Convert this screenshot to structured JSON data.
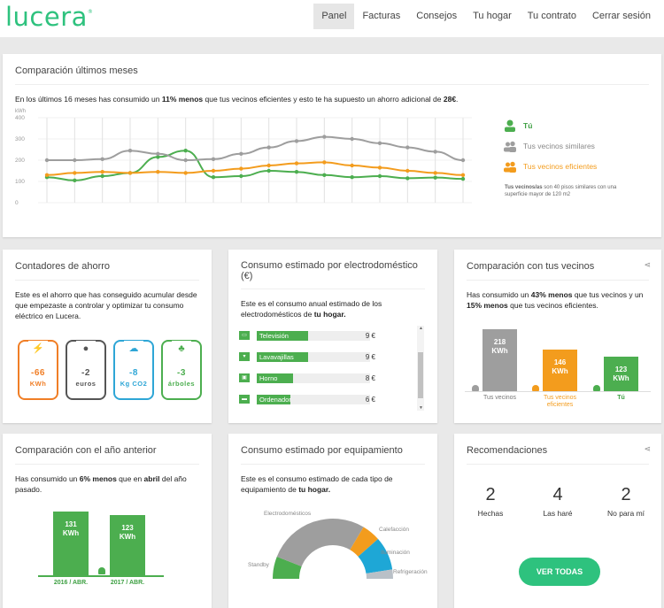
{
  "brand": {
    "name": "lucera",
    "accent": "#2ec27e"
  },
  "nav": [
    "Panel",
    "Facturas",
    "Consejos",
    "Tu hogar",
    "Tu contrato",
    "Cerrar sesión"
  ],
  "comparison": {
    "title": "Comparación últimos meses",
    "desc_pre": "En los últimos 16 meses has consumido un ",
    "desc_pct": "11% menos",
    "desc_mid": " que tus vecinos eficientes y esto te ha supuesto un ahorro adicional de ",
    "desc_amount": "28€",
    "desc_end": ".",
    "legend": [
      "Tú",
      "Tus vecinos similares",
      "Tus vecinos eficientes"
    ],
    "note_bold": "Tus vecinos/as",
    "note": " son 40 pisos similares con una superficie mayor de 120 m2"
  },
  "chart_data": {
    "type": "line",
    "ylabel": "kWh",
    "ylim": [
      0,
      400
    ],
    "yticks": [
      "0",
      "100",
      "200",
      "300",
      "400"
    ],
    "x": [
      1,
      2,
      3,
      4,
      5,
      6,
      7,
      8,
      9,
      10,
      11,
      12,
      13,
      14,
      15,
      16
    ],
    "series": [
      {
        "name": "Tú",
        "color": "#4cae4f",
        "values": [
          120,
          105,
          125,
          140,
          215,
          245,
          120,
          125,
          150,
          145,
          130,
          120,
          125,
          115,
          118,
          112
        ]
      },
      {
        "name": "Tus vecinos similares",
        "color": "#9e9e9e",
        "values": [
          200,
          200,
          205,
          245,
          230,
          200,
          205,
          230,
          260,
          290,
          310,
          300,
          280,
          260,
          240,
          200
        ]
      },
      {
        "name": "Tus vecinos eficientes",
        "color": "#f39c1d",
        "values": [
          130,
          140,
          145,
          140,
          145,
          140,
          150,
          160,
          175,
          185,
          190,
          175,
          165,
          150,
          140,
          130
        ]
      }
    ]
  },
  "counters": {
    "title": "Contadores de ahorro",
    "desc": "Este es el ahorro que has conseguido acumular desde que empezaste a controlar y optimizar tu consumo eléctrico en Lucera.",
    "items": [
      {
        "icon": "bolt-icon",
        "glyph": "⚡",
        "value": "-66",
        "unit": "KWh",
        "color": "#f07e26"
      },
      {
        "icon": "piggy-bank-icon",
        "glyph": "●",
        "value": "-2",
        "unit": "euros",
        "color": "#555555"
      },
      {
        "icon": "cloud-icon",
        "glyph": "☁",
        "value": "-8",
        "unit": "Kg CO2",
        "color": "#2ea6d6"
      },
      {
        "icon": "tree-icon",
        "glyph": "♣",
        "value": "-3",
        "unit": "árboles",
        "color": "#4cae4f"
      }
    ]
  },
  "appliances": {
    "title": "Consumo estimado por electrodoméstico (€)",
    "desc_pre": "Este es el consumo anual estimado de los electrodomésticos de ",
    "desc_bold": "tu hogar.",
    "items": [
      {
        "name": "Televisión",
        "value": "9 €",
        "fill": 0.45,
        "icon": "tv-icon"
      },
      {
        "name": "Lavavajillas",
        "value": "9 €",
        "fill": 0.45,
        "icon": "dishwasher-icon"
      },
      {
        "name": "Horno",
        "value": "8 €",
        "fill": 0.32,
        "icon": "oven-icon"
      },
      {
        "name": "Ordenador",
        "value": "6 €",
        "fill": 0.3,
        "icon": "laptop-icon"
      }
    ]
  },
  "neighbors": {
    "title": "Comparación con tus vecinos",
    "desc_pre": "Has consumido un ",
    "desc_pct1": "43% menos",
    "desc_mid": " que tus vecinos y un ",
    "desc_pct2": "15% menos",
    "desc_end": " que tus vecinos eficientes.",
    "bars": [
      {
        "label": "Tus vecinos",
        "value": "218",
        "unit": "KWh",
        "color": "#9e9e9e",
        "kwh": 218
      },
      {
        "label": "Tus vecinos eficientes",
        "value": "146",
        "unit": "KWh",
        "color": "#f39c1d",
        "kwh": 146
      },
      {
        "label": "Tú",
        "value": "123",
        "unit": "KWh",
        "color": "#4cae4f",
        "kwh": 123
      }
    ]
  },
  "yearcmp": {
    "title": "Comparación con el año anterior",
    "desc_pre": "Has consumido un ",
    "desc_pct": "6% menos",
    "desc_mid": " que en ",
    "desc_month": "abril",
    "desc_end": " del año pasado.",
    "bars": [
      {
        "label": "2016 / ABR.",
        "value": "131",
        "unit": "KWh",
        "kwh": 131
      },
      {
        "label": "2017 / ABR.",
        "value": "123",
        "unit": "KWh",
        "kwh": 123
      }
    ]
  },
  "equipment": {
    "title": "Consumo estimado por equipamiento",
    "desc_pre": "Este es el consumo estimado de cada tipo de equipamiento de ",
    "desc_bold": "tu hogar.",
    "segments": [
      {
        "name": "Standby",
        "share": 0.12,
        "color": "#4cae4f"
      },
      {
        "name": "Electrodomésticos",
        "share": 0.55,
        "color": "#9e9e9e"
      },
      {
        "name": "Calefacción",
        "share": 0.1,
        "color": "#f39c1d"
      },
      {
        "name": "Iluminación",
        "share": 0.18,
        "color": "#1ea7d6"
      },
      {
        "name": "Refrigeración",
        "share": 0.05,
        "color": "#b9c0c7"
      }
    ]
  },
  "recommendations": {
    "title": "Recomendaciones",
    "items": [
      {
        "count": "2",
        "label": "Hechas"
      },
      {
        "count": "4",
        "label": "Las haré"
      },
      {
        "count": "2",
        "label": "No para mí"
      }
    ],
    "button": "VER TODAS"
  }
}
